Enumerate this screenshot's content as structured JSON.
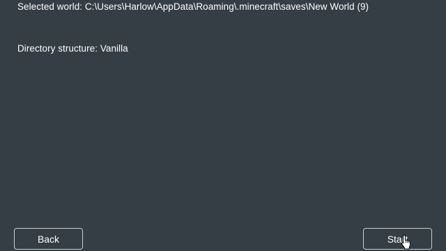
{
  "info": {
    "selected_world_label": "Selected world:",
    "selected_world_path": "C:\\Users\\Harlow\\AppData\\Roaming\\.minecraft\\saves\\New World (9)",
    "directory_structure_label": "Directory structure:",
    "directory_structure_value": "Vanilla"
  },
  "buttons": {
    "back_label": "Back",
    "start_label": "Start"
  },
  "cursor": {
    "icon": "hand-pointer-icon"
  },
  "colors": {
    "background": "#343e44",
    "text": "#ffffff",
    "button_border": "#c9ced1"
  }
}
